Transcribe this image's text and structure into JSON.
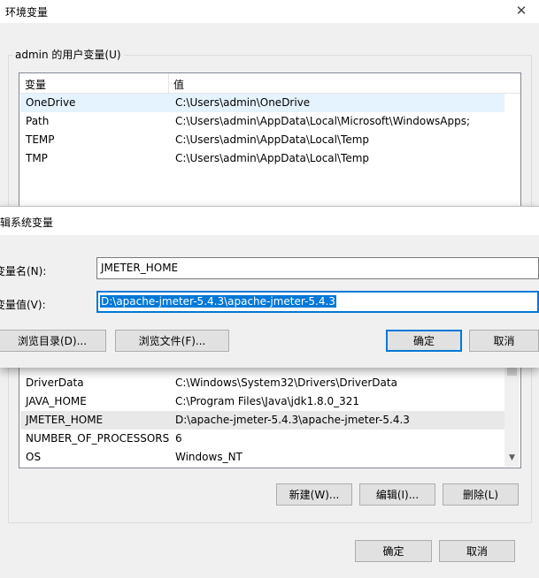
{
  "window": {
    "title": "环境变量",
    "close_glyph": "✕"
  },
  "user_vars": {
    "group_label": "admin 的用户变量(U)",
    "headers": [
      "变量",
      "值"
    ],
    "rows": [
      {
        "name": "OneDrive",
        "value": "C:\\Users\\admin\\OneDrive"
      },
      {
        "name": "Path",
        "value": "C:\\Users\\admin\\AppData\\Local\\Microsoft\\WindowsApps;"
      },
      {
        "name": "TEMP",
        "value": "C:\\Users\\admin\\AppData\\Local\\Temp"
      },
      {
        "name": "TMP",
        "value": "C:\\Users\\admin\\AppData\\Local\\Temp"
      }
    ]
  },
  "system_vars": {
    "rows": [
      {
        "name": "DriverData",
        "value": "C:\\Windows\\System32\\Drivers\\DriverData"
      },
      {
        "name": "JAVA_HOME",
        "value": "C:\\Program Files\\Java\\jdk1.8.0_321"
      },
      {
        "name": "JMETER_HOME",
        "value": "D:\\apache-jmeter-5.4.3\\apache-jmeter-5.4.3"
      },
      {
        "name": "NUMBER_OF_PROCESSORS",
        "value": "6"
      },
      {
        "name": "OS",
        "value": "Windows_NT"
      }
    ],
    "buttons": {
      "new": "新建(W)...",
      "edit": "编辑(I)...",
      "delete": "删除(L)"
    }
  },
  "footer": {
    "ok": "确定",
    "cancel": "取消"
  },
  "edit_dialog": {
    "title": "辑系统变量",
    "name_label": "变量名(N):",
    "name_value": "JMETER_HOME",
    "value_label": "变量值(V):",
    "value_value": "D:\\apache-jmeter-5.4.3\\apache-jmeter-5.4.3",
    "browse_dir": "浏览目录(D)...",
    "browse_file": "浏览文件(F)...",
    "ok": "确定",
    "cancel": "取消"
  },
  "colors": {
    "accent": "#0078d7",
    "selection": "#e5f3ff"
  }
}
